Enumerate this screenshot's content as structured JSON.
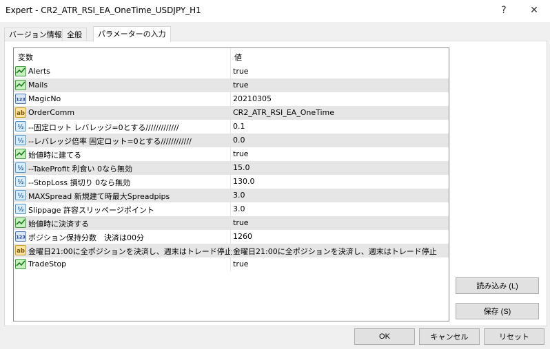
{
  "window": {
    "title": "Expert - CR2_ATR_RSI_EA_OneTime_USDJPY_H1",
    "help": "?",
    "close": "✕"
  },
  "tabs": [
    {
      "label": "バージョン情報"
    },
    {
      "label": "全般"
    },
    {
      "label": "パラメーターの入力"
    }
  ],
  "grid": {
    "col_variable": "変数",
    "col_value": "値",
    "rows": [
      {
        "icon": "bool-icon",
        "name": "Alerts",
        "value": "true"
      },
      {
        "icon": "bool-icon",
        "name": "Mails",
        "value": "true"
      },
      {
        "icon": "int-icon",
        "name": "MagicNo",
        "value": "20210305"
      },
      {
        "icon": "string-icon",
        "name": "OrderComm",
        "value": "CR2_ATR_RSI_EA_OneTime"
      },
      {
        "icon": "double-icon",
        "name": "--固定ロット レバレッジ=0とする/////////////",
        "value": "0.1"
      },
      {
        "icon": "double-icon",
        "name": "--レバレッジ倍率 固定ロット=0とする////////////",
        "value": "0.0"
      },
      {
        "icon": "bool-icon",
        "name": "始値時に建てる",
        "value": "true"
      },
      {
        "icon": "double-icon",
        "name": "--TakeProfit 利食い 0なら無効",
        "value": "15.0"
      },
      {
        "icon": "double-icon",
        "name": "--StopLoss 損切り 0なら無効",
        "value": "130.0"
      },
      {
        "icon": "double-icon",
        "name": "MAXSpread 新規建て時最大Spreadpips",
        "value": "3.0"
      },
      {
        "icon": "double-icon",
        "name": "Slippage 許容スリッページポイント",
        "value": "3.0"
      },
      {
        "icon": "bool-icon",
        "name": "始値時に決済する",
        "value": "true"
      },
      {
        "icon": "int-icon",
        "name": "ポジション保持分数　決済は00分",
        "value": "1260"
      },
      {
        "icon": "string-icon",
        "name": "金曜日21:00に全ポジションを決済し、週末はトレード停止",
        "value": "金曜日21:00に全ポジションを決済し、週末はトレード停止"
      },
      {
        "icon": "bool-icon",
        "name": "TradeStop",
        "value": "true"
      }
    ]
  },
  "buttons": {
    "load": "読み込み (L)",
    "save": "保存 (S)",
    "ok": "OK",
    "cancel": "キャンセル",
    "reset": "リセット"
  },
  "icon_text": {
    "int": "123",
    "string": "ab",
    "double": "½"
  }
}
